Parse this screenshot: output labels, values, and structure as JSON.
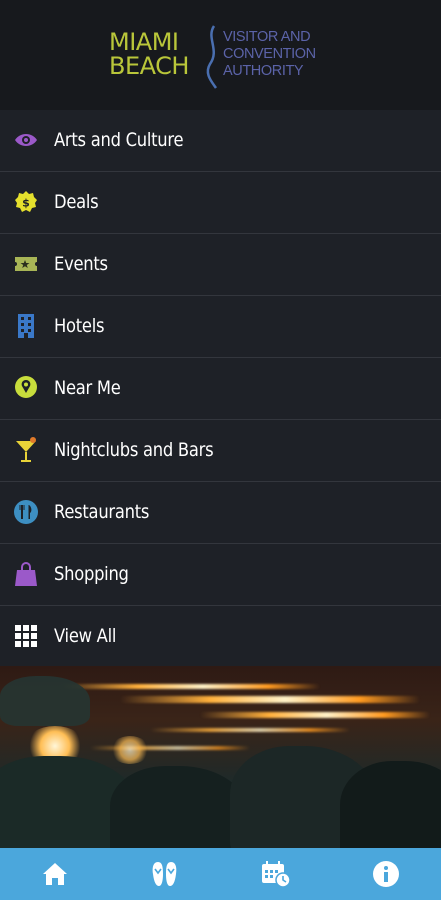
{
  "header": {
    "logo_left_line1": "MIAMI",
    "logo_left_line2": "BEACH",
    "logo_right_line1": "VISITOR AND",
    "logo_right_line2": "CONVENTION",
    "logo_right_line3": "AUTHORITY"
  },
  "menu": {
    "items": [
      {
        "label": "Arts and Culture",
        "icon": "eye-icon"
      },
      {
        "label": "Deals",
        "icon": "dollar-badge-icon"
      },
      {
        "label": "Events",
        "icon": "ticket-icon"
      },
      {
        "label": "Hotels",
        "icon": "building-icon"
      },
      {
        "label": "Near Me",
        "icon": "location-pin-icon"
      },
      {
        "label": "Nightclubs and Bars",
        "icon": "martini-icon"
      },
      {
        "label": "Restaurants",
        "icon": "fork-knife-icon"
      },
      {
        "label": "Shopping",
        "icon": "shopping-bag-icon"
      },
      {
        "label": "View All",
        "icon": "grid-icon"
      }
    ]
  },
  "bottom_nav": {
    "items": [
      {
        "icon": "home-icon"
      },
      {
        "icon": "flip-flops-icon"
      },
      {
        "icon": "calendar-clock-icon"
      },
      {
        "icon": "info-icon"
      }
    ]
  },
  "colors": {
    "header_bg": "#17191d",
    "menu_bg": "#1e2127",
    "logo_green": "#b9c63a",
    "logo_blue": "#5b63a8",
    "nav_bg": "#4ba7dc"
  }
}
